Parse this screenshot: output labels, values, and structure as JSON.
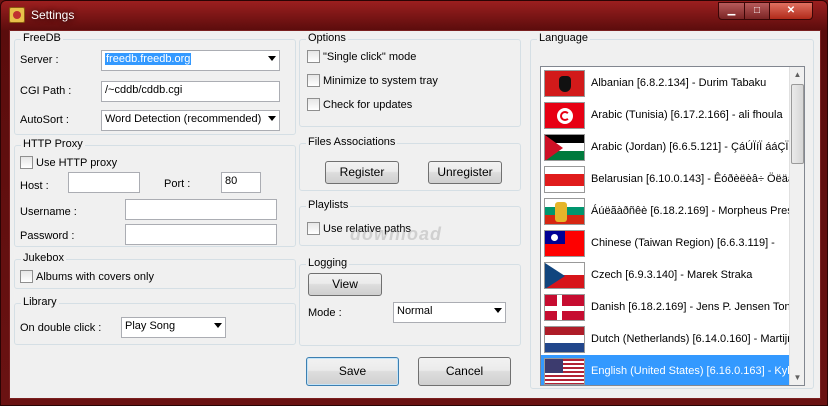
{
  "window": {
    "title": "Settings"
  },
  "freedb": {
    "title": "FreeDB",
    "server_label": "Server :",
    "server_value": "freedb.freedb.org",
    "cgi_label": "CGI Path :",
    "cgi_value": "/~cddb/cddb.cgi",
    "autosort_label": "AutoSort :",
    "autosort_value": "Word Detection (recommended)"
  },
  "proxy": {
    "title": "HTTP Proxy",
    "use_label": "Use HTTP proxy",
    "host_label": "Host :",
    "host_value": "",
    "port_label": "Port :",
    "port_value": "80",
    "username_label": "Username :",
    "username_value": "",
    "password_label": "Password :",
    "password_value": ""
  },
  "jukebox": {
    "title": "Jukebox",
    "albums_label": "Albums with covers only"
  },
  "library": {
    "title": "Library",
    "double_click_label": "On double click :",
    "double_click_value": "Play Song"
  },
  "options": {
    "title": "Options",
    "single_click_label": "\"Single click\"  mode",
    "minimize_label": "Minimize to system tray",
    "updates_label": "Check for updates"
  },
  "files": {
    "title": "Files Associations",
    "register_label": "Register",
    "unregister_label": "Unregister"
  },
  "playlists": {
    "title": "Playlists",
    "relative_label": "Use relative paths"
  },
  "logging": {
    "title": "Logging",
    "view_label": "View",
    "mode_label": "Mode :",
    "mode_value": "Normal"
  },
  "footer": {
    "save_label": "Save",
    "cancel_label": "Cancel"
  },
  "watermark": "download",
  "language": {
    "title": "Language",
    "items": [
      {
        "label": "Albanian [6.8.2.134] - Durim Tabaku",
        "flag": "flag-albania-icon"
      },
      {
        "label": "Arabic (Tunisia) [6.17.2.166] - ali fhoula",
        "flag": "flag-tunisia-icon"
      },
      {
        "label": "Arabic (Jordan) [6.6.5.121] - ÇáÚÏíÏ ááÇÏä",
        "flag": "flag-jordan-icon"
      },
      {
        "label": "Belarusian [6.10.0.143] - Êóðèëèâ÷ Öëäà",
        "flag": "flag-belarus-icon"
      },
      {
        "label": "Áúëãàðñêè [6.18.2.169] - Morpheus Presc",
        "flag": "flag-bulgaria-icon"
      },
      {
        "label": "Chinese (Taiwan Region) [6.6.3.119] -",
        "flag": "flag-taiwan-icon"
      },
      {
        "label": "Czech [6.9.3.140] - Marek Straka",
        "flag": "flag-czech-icon"
      },
      {
        "label": "Danish [6.18.2.169] - Jens P. Jensen Tona",
        "flag": "flag-denmark-icon"
      },
      {
        "label": "Dutch (Netherlands) [6.14.0.160] - Martijn",
        "flag": "flag-netherlands-icon"
      },
      {
        "label": "English (United States) [6.16.0.163] - Kyle",
        "flag": "flag-usa-icon"
      }
    ],
    "selected_index": 9
  }
}
